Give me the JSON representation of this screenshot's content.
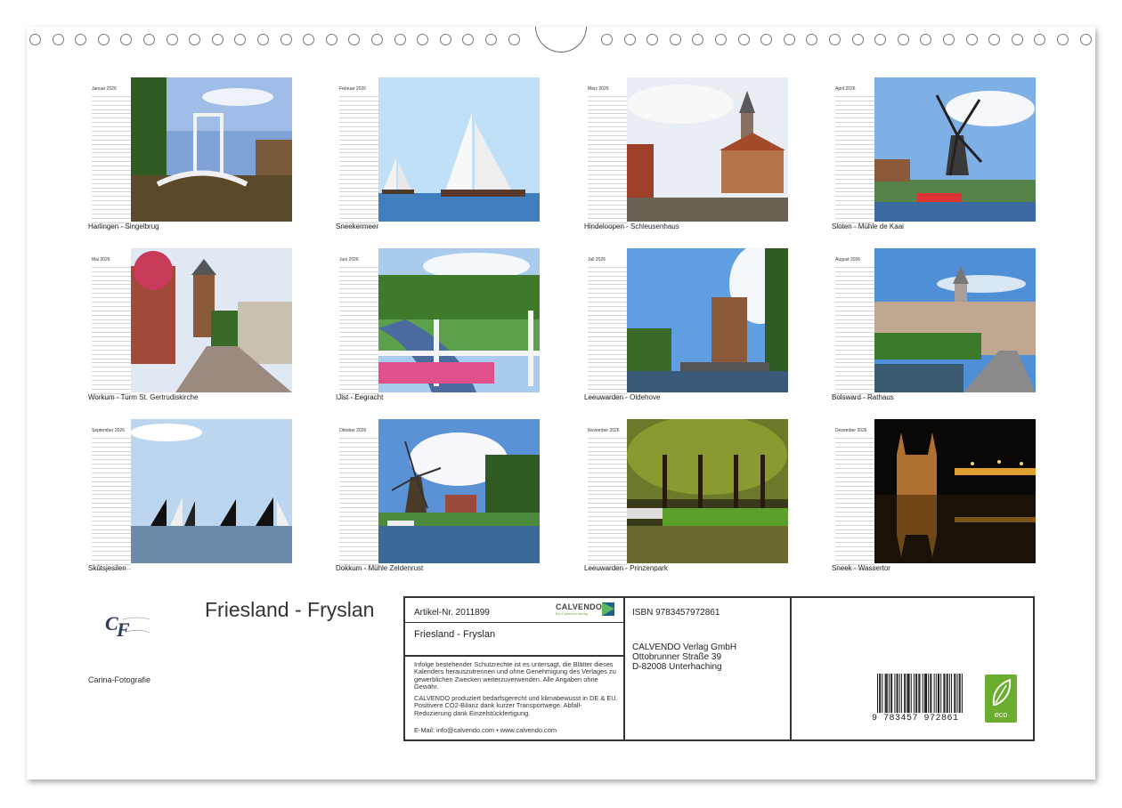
{
  "months": [
    {
      "title": "Januar 2026",
      "caption": "Harlingen - Singelbrug",
      "scene": "bridge"
    },
    {
      "title": "Februar 2026",
      "caption": "Sneekermeer",
      "scene": "sail"
    },
    {
      "title": "März 2026",
      "caption": "Hindeloopen - Schleusenhaus",
      "scene": "church"
    },
    {
      "title": "April 2026",
      "caption": "Sloten - Mühle de Kaai",
      "scene": "mill"
    },
    {
      "title": "Mai 2026",
      "caption": "Workum - Turm St. Gertrudiskirche",
      "scene": "street"
    },
    {
      "title": "Juni 2026",
      "caption": "IJlst - Eegracht",
      "scene": "canal"
    },
    {
      "title": "Juli 2026",
      "caption": "Leeuwarden - Oldehove",
      "scene": "tower"
    },
    {
      "title": "August 2026",
      "caption": "Bolsward - Rathaus",
      "scene": "townhall"
    },
    {
      "title": "September 2026",
      "caption": "Skûtsjesilen",
      "scene": "regatta"
    },
    {
      "title": "Oktober 2026",
      "caption": "Dokkum - Mühle Zeldenrust",
      "scene": "mill2"
    },
    {
      "title": "November 2026",
      "caption": "Leeuwarden - Prinzenpark",
      "scene": "park"
    },
    {
      "title": "Dezember 2026",
      "caption": "Sneek - Wassertor",
      "scene": "night"
    }
  ],
  "cover": {
    "title": "Friesland - Fryslan",
    "author": "Carina-Fotografie"
  },
  "info": {
    "article": "Artikel-Nr. 2011899",
    "brand": "CALVENDO",
    "brand_tagline": "Bei Calvendo verlag",
    "product_title": "Friesland - Fryslan",
    "legal": "Infolge bestehender Schutzrechte ist es untersagt, die Blätter dieses Kalenders herauszutrennen und ohne Genehmigung des Verlages zu gewerblichen Zwecken weiterzuverwenden. Alle Angaben ohne Gewähr.",
    "eco_text": "CALVENDO produziert bedarfsgerecht und klimabewusst in DE & EU. Positivere CO2-Bilanz dank kurzer Transportwege. Abfall-Reduzierung dank Einzelstückfertigung.",
    "contact": "E-Mail: info@calvendo.com • www.calvendo.com",
    "isbn": "ISBN 9783457972861",
    "publisher_1": "CALVENDO Verlag GmbH",
    "publisher_2": "Ottobrunner Straße 39",
    "publisher_3": "D-82008 Unterhaching",
    "barcode_text": "9 783457 972861",
    "eco_label": "eco"
  },
  "colors": {
    "accent": "#6bae2f",
    "line": "#333333"
  }
}
